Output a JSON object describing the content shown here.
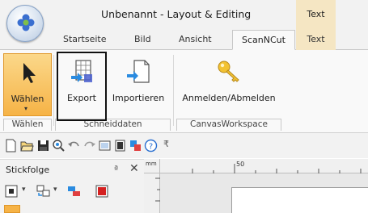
{
  "window": {
    "title": "Unbenannt - Layout & Editing",
    "context_label": "Text"
  },
  "tabs": [
    {
      "label": "Startseite"
    },
    {
      "label": "Bild"
    },
    {
      "label": "Ansicht"
    },
    {
      "label": "ScanNCut",
      "active": true
    },
    {
      "label": "Text",
      "context": true
    }
  ],
  "ribbon": {
    "groups": [
      {
        "label": "Wählen",
        "buttons": [
          {
            "label": "Wählen",
            "icon": "arrow-cursor-icon",
            "selected": true
          }
        ]
      },
      {
        "label": "Schneiddaten",
        "buttons": [
          {
            "label": "Export",
            "icon": "export-grid-icon",
            "highlighted": true
          },
          {
            "label": "Importieren",
            "icon": "import-document-icon"
          }
        ]
      },
      {
        "label": "CanvasWorkspace",
        "buttons": [
          {
            "label": "Anmelden/Abmelden",
            "icon": "key-icon"
          }
        ]
      }
    ]
  },
  "quick_access": {
    "icons": [
      "new-document-icon",
      "open-folder-icon",
      "save-icon",
      "zoom-icon",
      "undo-icon",
      "redo-icon",
      "view-icon",
      "display-icon",
      "transfer-icon",
      "help-icon",
      "customize-icon"
    ]
  },
  "panel": {
    "title": "Stickfolge",
    "pin": "ª",
    "close": "✕",
    "tools": [
      "frame-select-icon",
      "sequence-icon",
      "color-sort-icon",
      "stop-icon"
    ]
  },
  "ruler": {
    "unit": "mm",
    "tick_label": "50"
  },
  "colors": {
    "accent_selected": "#f6b346",
    "context_tab": "#f5e6c3",
    "stop_red": "#d42020"
  }
}
